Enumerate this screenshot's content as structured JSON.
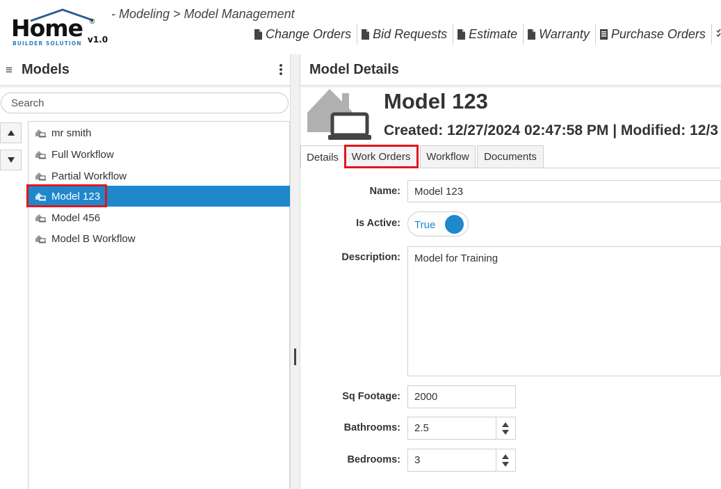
{
  "app": {
    "logo_word": "Home",
    "logo_sub": "BUILDER SOLUTION",
    "logo_version": "v1.0",
    "logo_reg": "®",
    "breadcrumb": "- Modeling > Model Management"
  },
  "nav": {
    "items": [
      "Change Orders",
      "Bid Requests",
      "Estimate",
      "Warranty",
      "Purchase Orders"
    ]
  },
  "left": {
    "title": "Models",
    "hamburger": "≡",
    "search_placeholder": "Search",
    "models": [
      "mr smith",
      "Full Workflow",
      "Partial Workflow",
      "Model 123",
      "Model 456",
      "Model B Workflow"
    ],
    "selected": "Model 123"
  },
  "right": {
    "title": "Model Details",
    "model_name": "Model 123",
    "meta": "Created: 12/27/2024 02:47:58 PM | Modified: 12/3",
    "tabs": [
      "Details",
      "Work Orders",
      "Workflow",
      "Documents"
    ],
    "active_tab": "Details",
    "highlighted_tab": "Work Orders"
  },
  "form": {
    "name_label": "Name:",
    "name_value": "Model 123",
    "active_label": "Is Active:",
    "active_value": "True",
    "desc_label": "Description:",
    "desc_value": "Model for Training",
    "sqft_label": "Sq Footage:",
    "sqft_value": "2000",
    "bath_label": "Bathrooms:",
    "bath_value": "2.5",
    "bed_label": "Bedrooms:",
    "bed_value": "3"
  },
  "colors": {
    "accent": "#1f87cc",
    "highlight": "#e0161d",
    "icon_gray": "#b0b0b0"
  },
  "icons": {
    "nav": "document-icon",
    "list": "house-laptop-icon",
    "kebab": "kebab-menu-icon",
    "up": "arrow-up-icon",
    "down": "arrow-down-icon"
  }
}
